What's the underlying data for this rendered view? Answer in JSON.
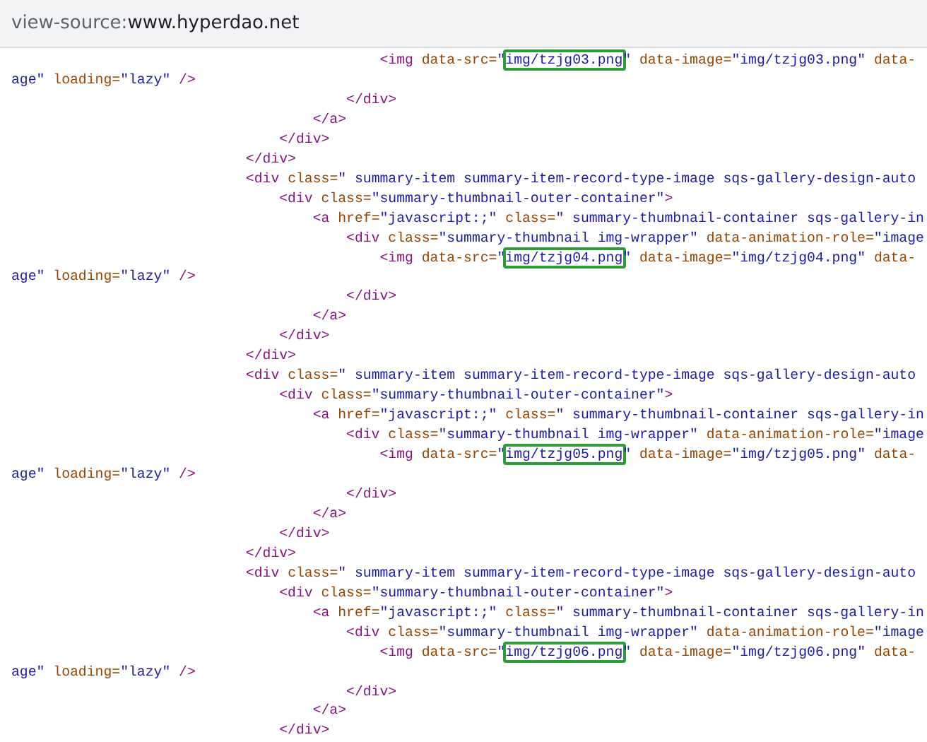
{
  "address_bar": {
    "scheme": "view-source:",
    "url": "www.hyperdao.net"
  },
  "lines": [
    {
      "children": [
        {
          "children": [
            {
              "children": [
                {
                  "children": [
                    {
                      "tokens": [
                        {
                          "kind": "tag",
                          "text": "<img"
                        },
                        {
                          "kind": "attr",
                          "text": " data-src="
                        },
                        {
                          "kind": "value",
                          "text": "\""
                        },
                        {
                          "kind": "boxed",
                          "text": "img/tzjg03.png"
                        },
                        {
                          "kind": "value",
                          "text": "\""
                        },
                        {
                          "kind": "attr",
                          "text": " data-image="
                        },
                        {
                          "kind": "value",
                          "text": "\"img/tzjg03.png\""
                        },
                        {
                          "kind": "attr",
                          "text": " data-"
                        }
                      ]
                    },
                    {
                      "kind": "wrap",
                      "tokens": [
                        {
                          "kind": "value",
                          "text": "age\""
                        },
                        {
                          "kind": "attr",
                          "text": " loading="
                        },
                        {
                          "kind": "value",
                          "text": "\"lazy\""
                        },
                        {
                          "kind": "tag",
                          "text": " />"
                        }
                      ]
                    }
                  ]
                },
                {
                  "tokens": [
                    {
                      "kind": "tag",
                      "text": "</div>"
                    }
                  ]
                }
              ]
            },
            {
              "tokens": [
                {
                  "kind": "tag",
                  "text": "</a>"
                }
              ]
            }
          ]
        },
        {
          "tokens": [
            {
              "kind": "tag",
              "text": "</div>"
            }
          ]
        }
      ]
    },
    {
      "tokens": [
        {
          "kind": "tag",
          "text": "</div>"
        }
      ]
    },
    {
      "tokens": [
        {
          "kind": "tag",
          "text": "<div"
        },
        {
          "kind": "attr",
          "text": " class="
        },
        {
          "kind": "value",
          "text": "\" summary-item summary-item-record-type-image sqs-gallery-design-auto"
        }
      ],
      "children": [
        {
          "tokens": [
            {
              "kind": "tag",
              "text": "<div"
            },
            {
              "kind": "attr",
              "text": " class="
            },
            {
              "kind": "value",
              "text": "\"summary-thumbnail-outer-container\""
            },
            {
              "kind": "tag",
              "text": ">"
            }
          ],
          "children": [
            {
              "tokens": [
                {
                  "kind": "tag",
                  "text": "<a"
                },
                {
                  "kind": "attr",
                  "text": " href="
                },
                {
                  "kind": "value",
                  "text": "\"javascript:;\""
                },
                {
                  "kind": "attr",
                  "text": " class="
                },
                {
                  "kind": "value",
                  "text": "\" summary-thumbnail-container sqs-gallery-in"
                }
              ],
              "children": [
                {
                  "tokens": [
                    {
                      "kind": "tag",
                      "text": "<div"
                    },
                    {
                      "kind": "attr",
                      "text": " class="
                    },
                    {
                      "kind": "value",
                      "text": "\"summary-thumbnail img-wrapper\""
                    },
                    {
                      "kind": "attr",
                      "text": " data-animation-role="
                    },
                    {
                      "kind": "value",
                      "text": "\"image"
                    }
                  ],
                  "children": [
                    {
                      "tokens": [
                        {
                          "kind": "tag",
                          "text": "<img"
                        },
                        {
                          "kind": "attr",
                          "text": " data-src="
                        },
                        {
                          "kind": "value",
                          "text": "\""
                        },
                        {
                          "kind": "boxed",
                          "text": "img/tzjg04.png"
                        },
                        {
                          "kind": "value",
                          "text": "\""
                        },
                        {
                          "kind": "attr",
                          "text": " data-image="
                        },
                        {
                          "kind": "value",
                          "text": "\"img/tzjg04.png\""
                        },
                        {
                          "kind": "attr",
                          "text": " data-"
                        }
                      ]
                    },
                    {
                      "kind": "wrap",
                      "tokens": [
                        {
                          "kind": "value",
                          "text": "age\""
                        },
                        {
                          "kind": "attr",
                          "text": " loading="
                        },
                        {
                          "kind": "value",
                          "text": "\"lazy\""
                        },
                        {
                          "kind": "tag",
                          "text": " />"
                        }
                      ]
                    }
                  ]
                },
                {
                  "tokens": [
                    {
                      "kind": "tag",
                      "text": "</div>"
                    }
                  ]
                }
              ]
            },
            {
              "tokens": [
                {
                  "kind": "tag",
                  "text": "</a>"
                }
              ]
            }
          ]
        },
        {
          "tokens": [
            {
              "kind": "tag",
              "text": "</div>"
            }
          ]
        }
      ]
    },
    {
      "tokens": [
        {
          "kind": "tag",
          "text": "</div>"
        }
      ]
    },
    {
      "tokens": [
        {
          "kind": "tag",
          "text": "<div"
        },
        {
          "kind": "attr",
          "text": " class="
        },
        {
          "kind": "value",
          "text": "\" summary-item summary-item-record-type-image sqs-gallery-design-auto"
        }
      ],
      "children": [
        {
          "tokens": [
            {
              "kind": "tag",
              "text": "<div"
            },
            {
              "kind": "attr",
              "text": " class="
            },
            {
              "kind": "value",
              "text": "\"summary-thumbnail-outer-container\""
            },
            {
              "kind": "tag",
              "text": ">"
            }
          ],
          "children": [
            {
              "tokens": [
                {
                  "kind": "tag",
                  "text": "<a"
                },
                {
                  "kind": "attr",
                  "text": " href="
                },
                {
                  "kind": "value",
                  "text": "\"javascript:;\""
                },
                {
                  "kind": "attr",
                  "text": " class="
                },
                {
                  "kind": "value",
                  "text": "\" summary-thumbnail-container sqs-gallery-in"
                }
              ],
              "children": [
                {
                  "tokens": [
                    {
                      "kind": "tag",
                      "text": "<div"
                    },
                    {
                      "kind": "attr",
                      "text": " class="
                    },
                    {
                      "kind": "value",
                      "text": "\"summary-thumbnail img-wrapper\""
                    },
                    {
                      "kind": "attr",
                      "text": " data-animation-role="
                    },
                    {
                      "kind": "value",
                      "text": "\"image"
                    }
                  ],
                  "children": [
                    {
                      "tokens": [
                        {
                          "kind": "tag",
                          "text": "<img"
                        },
                        {
                          "kind": "attr",
                          "text": " data-src="
                        },
                        {
                          "kind": "value",
                          "text": "\""
                        },
                        {
                          "kind": "boxed",
                          "text": "img/tzjg05.png"
                        },
                        {
                          "kind": "value",
                          "text": "\""
                        },
                        {
                          "kind": "attr",
                          "text": " data-image="
                        },
                        {
                          "kind": "value",
                          "text": "\"img/tzjg05.png\""
                        },
                        {
                          "kind": "attr",
                          "text": " data-"
                        }
                      ]
                    },
                    {
                      "kind": "wrap",
                      "tokens": [
                        {
                          "kind": "value",
                          "text": "age\""
                        },
                        {
                          "kind": "attr",
                          "text": " loading="
                        },
                        {
                          "kind": "value",
                          "text": "\"lazy\""
                        },
                        {
                          "kind": "tag",
                          "text": " />"
                        }
                      ]
                    }
                  ]
                },
                {
                  "tokens": [
                    {
                      "kind": "tag",
                      "text": "</div>"
                    }
                  ]
                }
              ]
            },
            {
              "tokens": [
                {
                  "kind": "tag",
                  "text": "</a>"
                }
              ]
            }
          ]
        },
        {
          "tokens": [
            {
              "kind": "tag",
              "text": "</div>"
            }
          ]
        }
      ]
    },
    {
      "tokens": [
        {
          "kind": "tag",
          "text": "</div>"
        }
      ]
    },
    {
      "tokens": [
        {
          "kind": "tag",
          "text": "<div"
        },
        {
          "kind": "attr",
          "text": " class="
        },
        {
          "kind": "value",
          "text": "\" summary-item summary-item-record-type-image sqs-gallery-design-auto"
        }
      ],
      "children": [
        {
          "tokens": [
            {
              "kind": "tag",
              "text": "<div"
            },
            {
              "kind": "attr",
              "text": " class="
            },
            {
              "kind": "value",
              "text": "\"summary-thumbnail-outer-container\""
            },
            {
              "kind": "tag",
              "text": ">"
            }
          ],
          "children": [
            {
              "tokens": [
                {
                  "kind": "tag",
                  "text": "<a"
                },
                {
                  "kind": "attr",
                  "text": " href="
                },
                {
                  "kind": "value",
                  "text": "\"javascript:;\""
                },
                {
                  "kind": "attr",
                  "text": " class="
                },
                {
                  "kind": "value",
                  "text": "\" summary-thumbnail-container sqs-gallery-in"
                }
              ],
              "children": [
                {
                  "tokens": [
                    {
                      "kind": "tag",
                      "text": "<div"
                    },
                    {
                      "kind": "attr",
                      "text": " class="
                    },
                    {
                      "kind": "value",
                      "text": "\"summary-thumbnail img-wrapper\""
                    },
                    {
                      "kind": "attr",
                      "text": " data-animation-role="
                    },
                    {
                      "kind": "value",
                      "text": "\"image"
                    }
                  ],
                  "children": [
                    {
                      "tokens": [
                        {
                          "kind": "tag",
                          "text": "<img"
                        },
                        {
                          "kind": "attr",
                          "text": " data-src="
                        },
                        {
                          "kind": "value",
                          "text": "\""
                        },
                        {
                          "kind": "boxed",
                          "text": "img/tzjg06.png"
                        },
                        {
                          "kind": "value",
                          "text": "\""
                        },
                        {
                          "kind": "attr",
                          "text": " data-image="
                        },
                        {
                          "kind": "value",
                          "text": "\"img/tzjg06.png\""
                        },
                        {
                          "kind": "attr",
                          "text": " data-"
                        }
                      ]
                    },
                    {
                      "kind": "wrap",
                      "tokens": [
                        {
                          "kind": "value",
                          "text": "age\""
                        },
                        {
                          "kind": "attr",
                          "text": " loading="
                        },
                        {
                          "kind": "value",
                          "text": "\"lazy\""
                        },
                        {
                          "kind": "tag",
                          "text": " />"
                        }
                      ]
                    }
                  ]
                },
                {
                  "tokens": [
                    {
                      "kind": "tag",
                      "text": "</div>"
                    }
                  ]
                }
              ]
            },
            {
              "tokens": [
                {
                  "kind": "tag",
                  "text": "</a>"
                }
              ]
            }
          ]
        },
        {
          "tokens": [
            {
              "kind": "tag",
              "text": "</div>"
            }
          ]
        }
      ]
    }
  ]
}
